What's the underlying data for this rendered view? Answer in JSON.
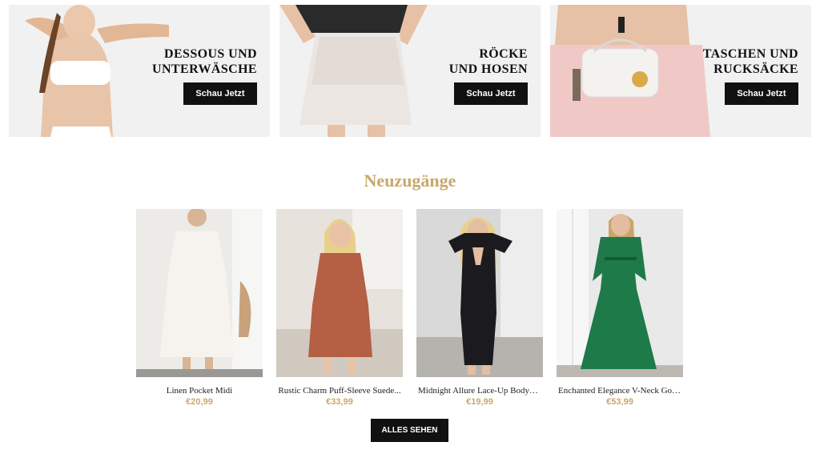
{
  "banners": [
    {
      "title_line1": "DESSOUS UND",
      "title_line2": "UNTERWÄSCHE",
      "button_label": "Schau Jetzt"
    },
    {
      "title_line1": "RÖCKE",
      "title_line2": "UND HOSEN",
      "button_label": "Schau Jetzt"
    },
    {
      "title_line1": "TASCHEN UND",
      "title_line2": "RUCKSÄCKE",
      "button_label": "Schau Jetzt"
    }
  ],
  "new_arrivals": {
    "title": "Neuzugänge",
    "products": [
      {
        "name": "Linen Pocket Midi",
        "price": "€20,99"
      },
      {
        "name": "Rustic Charm Puff-Sleeve Suede...",
        "price": "€33,99"
      },
      {
        "name": "Midnight Allure Lace-Up Bodyco...",
        "price": "€19,99"
      },
      {
        "name": "Enchanted Elegance V-Neck Gown",
        "price": "€53,99"
      }
    ],
    "see_all_label": "ALLES SEHEN"
  },
  "colors": {
    "accent": "#c9a86a",
    "button_bg": "#111111",
    "banner_bg": "#f1f1f1"
  }
}
